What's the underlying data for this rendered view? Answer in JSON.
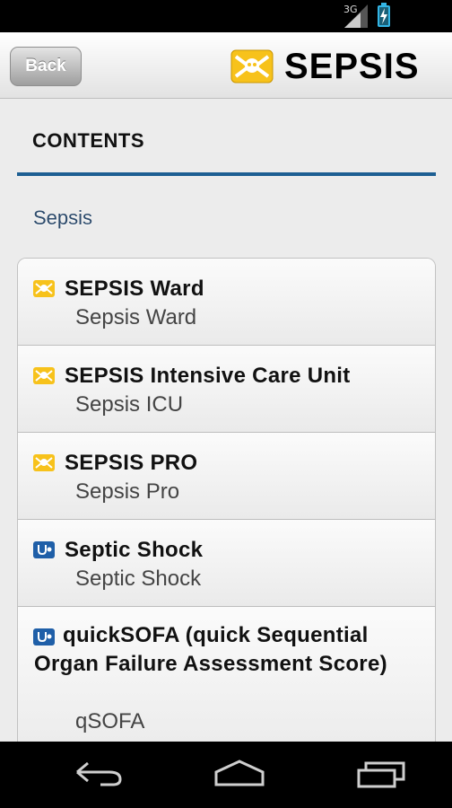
{
  "status_bar": {
    "signal_label": "3G",
    "signal_icon": "signal-icon",
    "battery_icon": "battery-charging-icon"
  },
  "header": {
    "back_label": "Back",
    "logo_text": "SEPSIS",
    "logo_icon": "sepsis-logo-icon"
  },
  "page": {
    "title": "CONTENTS",
    "section": "Sepsis"
  },
  "items": [
    {
      "title": "SEPSIS Ward",
      "subtitle": "Sepsis Ward",
      "icon": "sepsis-icon"
    },
    {
      "title": "SEPSIS Intensive Care Unit",
      "subtitle": "Sepsis ICU",
      "icon": "sepsis-icon"
    },
    {
      "title": "SEPSIS PRO",
      "subtitle": "Sepsis Pro",
      "icon": "sepsis-icon"
    },
    {
      "title": "Septic Shock",
      "subtitle": "Septic Shock",
      "icon": "stethoscope-icon"
    },
    {
      "title": "quickSOFA (quick Sequential Organ Failure Assessment Score)",
      "subtitle": "qSOFA",
      "icon": "stethoscope-icon"
    }
  ],
  "nav": {
    "back_icon": "nav-back-icon",
    "home_icon": "nav-home-icon",
    "recents_icon": "nav-recents-icon"
  },
  "colors": {
    "accent": "#1d5f93",
    "logo_yellow": "#f7c21b",
    "icon_blue": "#1f5fa8"
  }
}
